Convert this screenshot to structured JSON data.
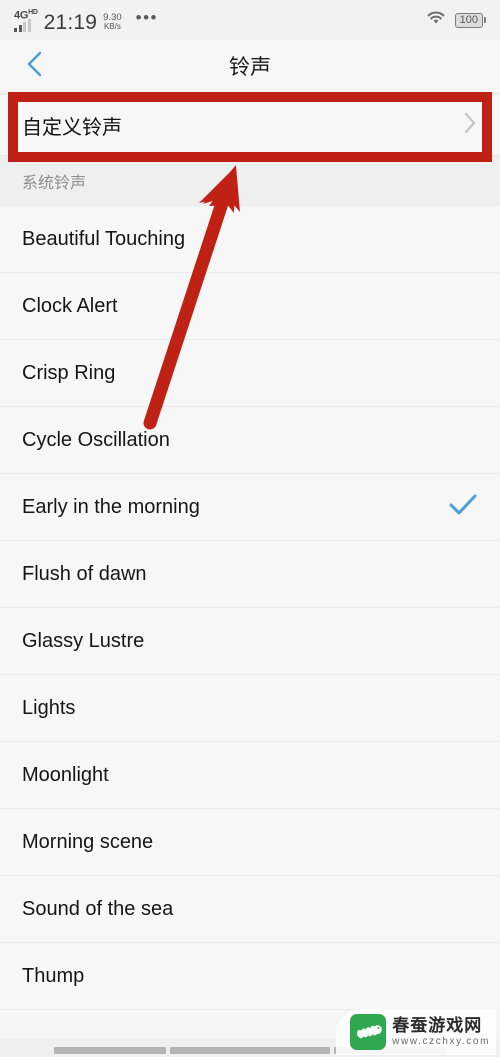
{
  "statusbar": {
    "network_label": "4G",
    "network_sup": "HD",
    "time": "21:19",
    "speed_value": "9.30",
    "speed_unit": "KB/s",
    "overflow": "•••",
    "wifi_icon": "wifi-icon",
    "battery_level": "100"
  },
  "header": {
    "back_icon": "back-chevron-icon",
    "title": "铃声"
  },
  "custom_ringtone": {
    "label": "自定义铃声",
    "chevron_icon": "chevron-right-icon"
  },
  "section": {
    "title": "系统铃声"
  },
  "ringtones": [
    {
      "name": "Beautiful Touching",
      "selected": false
    },
    {
      "name": "Clock Alert",
      "selected": false
    },
    {
      "name": "Crisp Ring",
      "selected": false
    },
    {
      "name": "Cycle Oscillation",
      "selected": false
    },
    {
      "name": "Early in the morning",
      "selected": true
    },
    {
      "name": "Flush of dawn",
      "selected": false
    },
    {
      "name": "Glassy Lustre",
      "selected": false
    },
    {
      "name": "Lights",
      "selected": false
    },
    {
      "name": "Moonlight",
      "selected": false
    },
    {
      "name": "Morning scene",
      "selected": false
    },
    {
      "name": "Sound of the sea",
      "selected": false
    },
    {
      "name": "Thump",
      "selected": false
    }
  ],
  "annotation": {
    "box_color": "#bf2115",
    "arrow_color": "#bf2115",
    "arrow_icon": "red-pointer-arrow-icon"
  },
  "watermark": {
    "title": "春蚕游戏网",
    "url": "www.czchxy.com",
    "logo_icon": "silkworm-logo-icon"
  },
  "navbar": {
    "back_icon": "nav-back-icon",
    "home_icon": "nav-home-icon",
    "recents_icon": "nav-recents-icon"
  },
  "colors": {
    "accent_blue": "#4a9fd8",
    "annotation_red": "#bf2115",
    "list_bg": "#f7f7f7"
  }
}
